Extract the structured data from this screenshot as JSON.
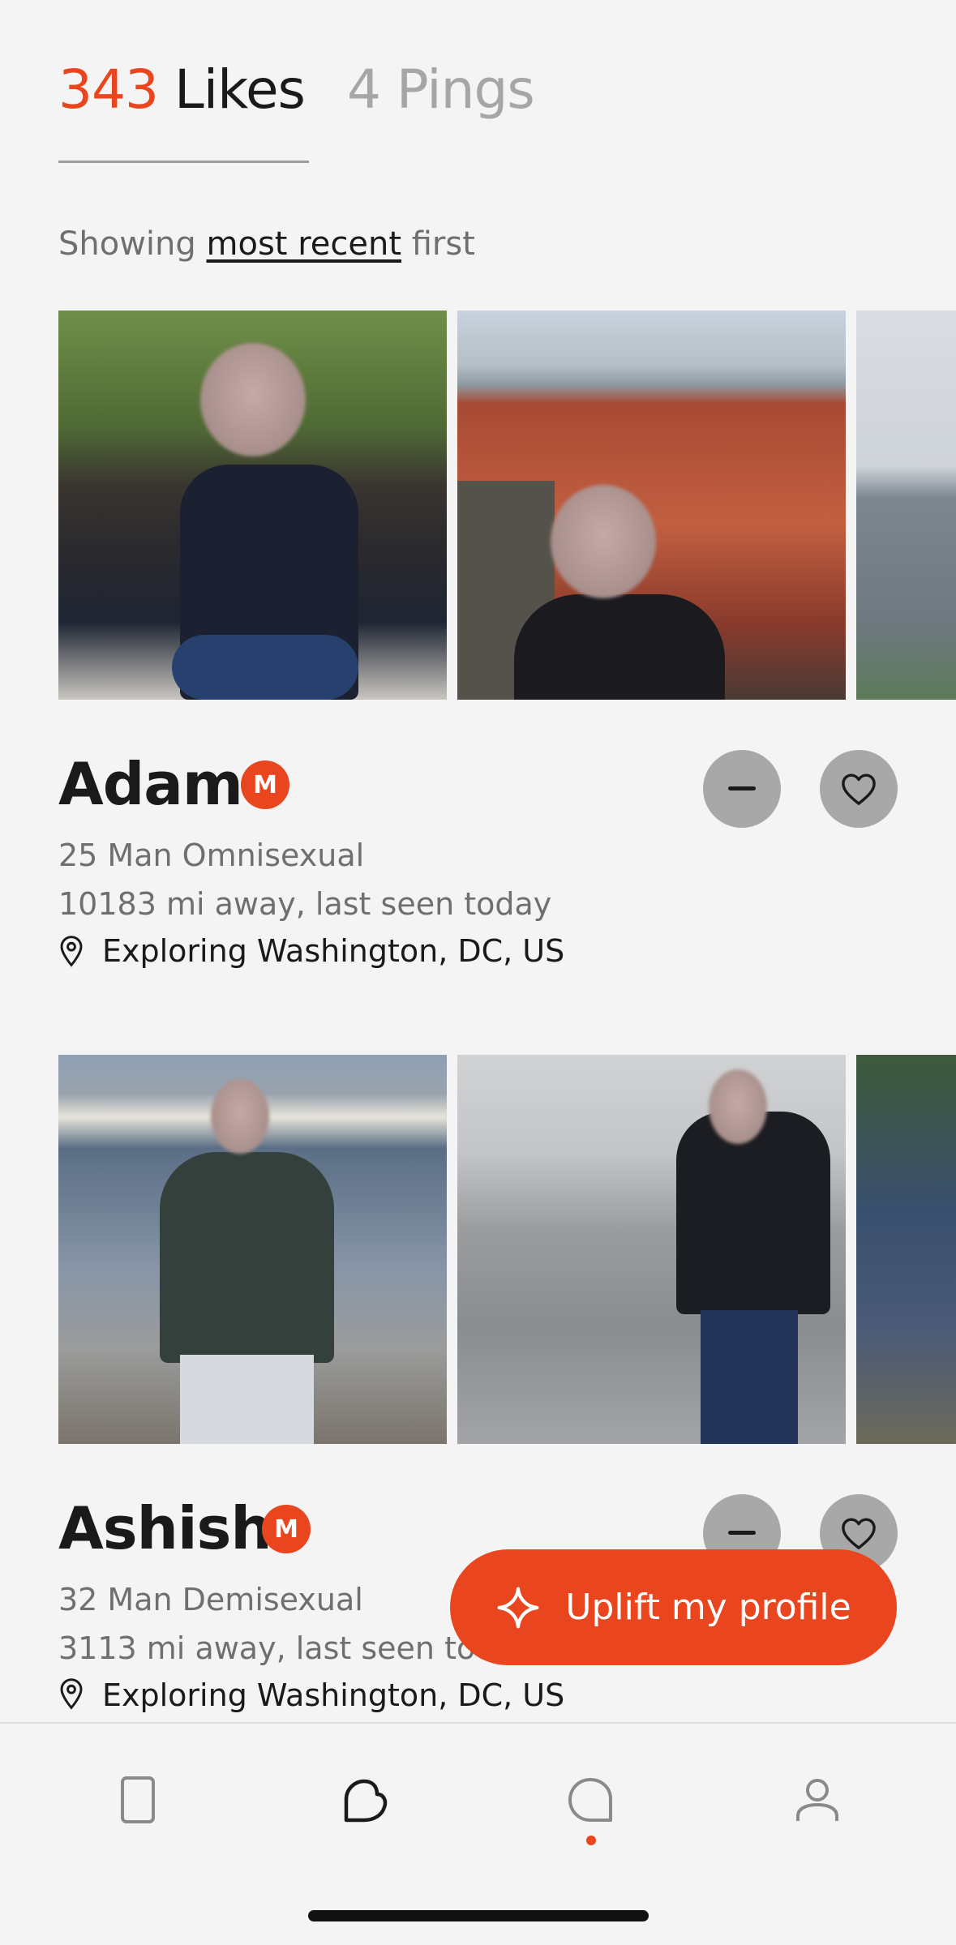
{
  "header": {
    "likes_count": "343",
    "likes_label": "Likes",
    "pings_count": "4",
    "pings_label": "Pings"
  },
  "sort": {
    "prefix": "Showing",
    "link": "most recent",
    "suffix": "first"
  },
  "profiles": [
    {
      "name": "Adam",
      "badge": "M",
      "details": "25 Man Omnisexual",
      "distance": "10183 mi away, last seen today",
      "location": "Exploring Washington, DC, US"
    },
    {
      "name": "Ashish",
      "badge": "M",
      "details": "32 Man Demisexual",
      "distance": "3113 mi away, last seen today",
      "location": "Exploring Washington, DC, US"
    }
  ],
  "cta": {
    "label": "Uplift my profile",
    "icon": "sparkle-icon"
  },
  "nav": {
    "items": [
      "cards-icon",
      "likes-icon",
      "chat-icon",
      "profile-icon"
    ],
    "active": "likes-icon",
    "notification_on": "chat-icon"
  },
  "colors": {
    "accent": "#e9451f",
    "muted": "#a6a6a6",
    "background": "#f4f4f4"
  }
}
